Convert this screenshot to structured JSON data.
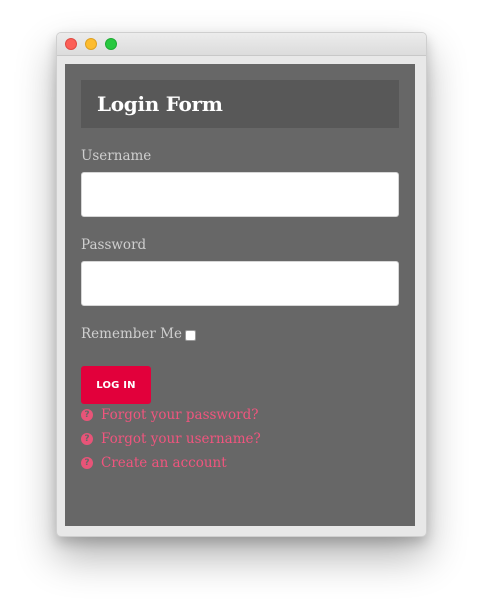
{
  "window": {
    "controls": [
      "close",
      "minimize",
      "maximize"
    ]
  },
  "form": {
    "title": "Login Form",
    "username_label": "Username",
    "username_value": "",
    "password_label": "Password",
    "password_value": "",
    "remember_label": "Remember Me",
    "remember_checked": false,
    "login_button": "LOG IN",
    "links": [
      {
        "label": "Forgot your password?",
        "icon": "question-circle-icon"
      },
      {
        "label": "Forgot your username?",
        "icon": "question-circle-icon"
      },
      {
        "label": "Create an account",
        "icon": "question-circle-icon"
      }
    ],
    "icon_glyph": "?"
  },
  "colors": {
    "accent": "#e2003b",
    "link": "#f0557e",
    "panel": "#676767",
    "header": "#585858"
  }
}
